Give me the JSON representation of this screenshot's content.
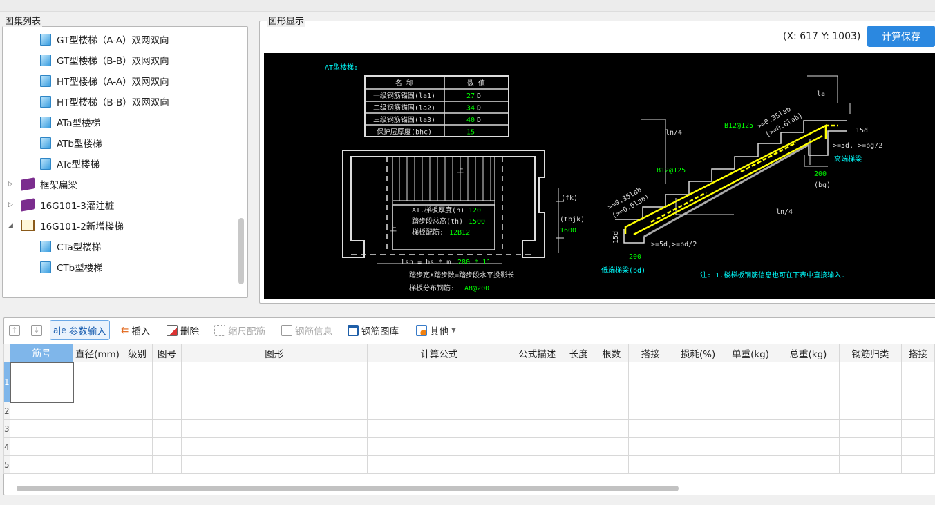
{
  "left_panel": {
    "title": "图集列表",
    "items": [
      {
        "label": "GT型楼梯（A-A）双网双向",
        "level": 2,
        "icon": "page"
      },
      {
        "label": "GT型楼梯（B-B）双网双向",
        "level": 2,
        "icon": "page"
      },
      {
        "label": "HT型楼梯（A-A）双网双向",
        "level": 2,
        "icon": "page"
      },
      {
        "label": "HT型楼梯（B-B）双网双向",
        "level": 2,
        "icon": "page"
      },
      {
        "label": "ATa型楼梯",
        "level": 2,
        "icon": "page"
      },
      {
        "label": "ATb型楼梯",
        "level": 2,
        "icon": "page"
      },
      {
        "label": "ATc型楼梯",
        "level": 2,
        "icon": "page"
      },
      {
        "label": "框架扁梁",
        "level": 1,
        "icon": "book",
        "expander": "▷"
      },
      {
        "label": "16G101-3灌注桩",
        "level": 1,
        "icon": "book",
        "expander": "▷"
      },
      {
        "label": "16G101-2新增楼梯",
        "level": 1,
        "icon": "open-book",
        "expander": "◢"
      },
      {
        "label": "CTa型楼梯",
        "level": 2,
        "icon": "page"
      },
      {
        "label": "CTb型楼梯",
        "level": 2,
        "icon": "page"
      }
    ]
  },
  "right_panel": {
    "title": "图形显示",
    "coords": "(X: 617 Y: 1003)",
    "calc_save": "计算保存"
  },
  "drawing": {
    "title": "AT型楼梯:",
    "table_head": [
      "名  称",
      "数  值"
    ],
    "table_rows": [
      [
        "一级钢筋锚固(la1)",
        "27",
        "D"
      ],
      [
        "二级钢筋锚固(la2)",
        "34",
        "D"
      ],
      [
        "三级钢筋锚固(la3)",
        "40",
        "D"
      ],
      [
        "保护层厚度(bhc)",
        "15",
        ""
      ]
    ],
    "plan_lines": [
      [
        "AT.梯板厚度(h)",
        "120"
      ],
      [
        "踏步段总高(th)",
        "1500"
      ],
      [
        "梯板配筋:",
        "12B12"
      ]
    ],
    "up1": "上",
    "up2": "上",
    "lsn_prefix": "lsn = bs * m",
    "lsn_vals": "280 * 11",
    "lsn_desc": "踏步宽X踏步数=踏步段水平投影长",
    "dist_label": "梯板分布钢筋:",
    "dist_val": "A8@200",
    "fk": "(fk)",
    "tbjk": "(tbjk)",
    "tbjk_val": "1600",
    "rebar1": "B12@125",
    "rebar2": "B12@125",
    "ln4a": "ln/4",
    "ln4b": "ln/4",
    "la": "la",
    "lab1": ">=0.35lab",
    "lab2": "(>=0.6lab)",
    "lab3": ">=0.35lab",
    "lab4": "(>=0.6lab)",
    "d15a": "15d",
    "d15b": "15d",
    "bg_rule": ">=5d, >=bg/2",
    "bd_rule": ">=5d,>=bd/2",
    "high_beam": "高端梯梁",
    "bg_w": "200",
    "bg": "(bg)",
    "bd_w": "200",
    "low_beam": "低端梯梁(bd)",
    "note": "注: 1.楼梯板钢筋信息也可在下表中直接输入."
  },
  "toolbar": {
    "move_up": "↑",
    "move_down": "↓",
    "param_input": "参数输入",
    "insert": "插入",
    "delete": "删除",
    "scale": "缩尺配筋",
    "info": "钢筋信息",
    "library": "钢筋图库",
    "other": "其他"
  },
  "table": {
    "columns": [
      "筋号",
      "直径(mm)",
      "级别",
      "图号",
      "图形",
      "计算公式",
      "公式描述",
      "长度",
      "根数",
      "搭接",
      "损耗(%)",
      "单重(kg)",
      "总重(kg)",
      "钢筋归类",
      "搭接"
    ],
    "row_numbers": [
      "1",
      "2",
      "3",
      "4",
      "5"
    ]
  },
  "colors": {
    "accent": "#2b88e0",
    "canvas": "#000000",
    "rebar": "#ffff00",
    "value_green": "#00ff00",
    "label_cyan": "#00ffff"
  }
}
